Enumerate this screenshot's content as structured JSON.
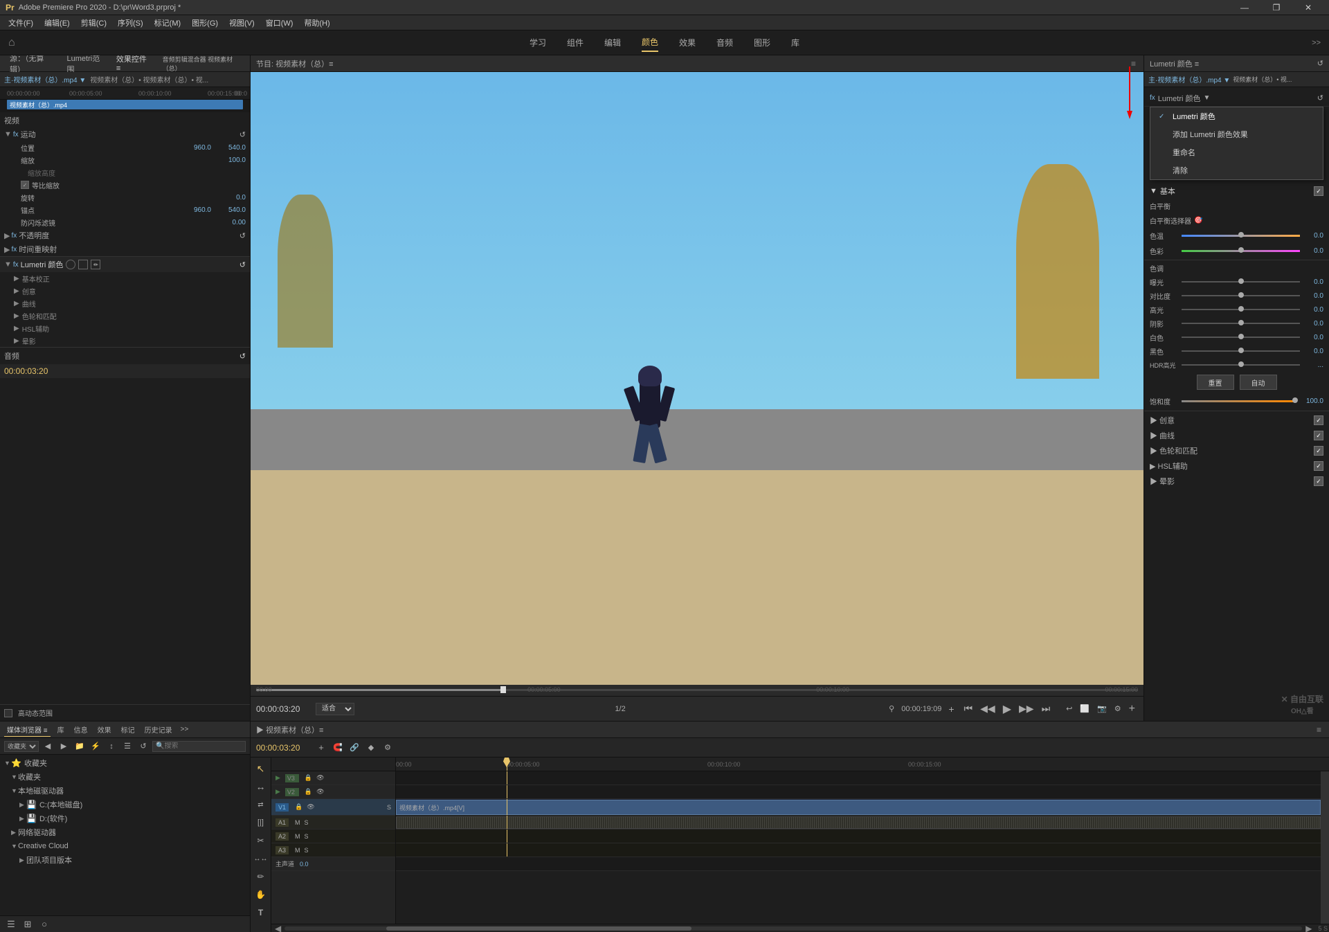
{
  "app": {
    "title": "Adobe Premiere Pro 2020 - D:\\pr\\Word3.prproj *",
    "minimize": "—",
    "restore": "❐",
    "close": "✕"
  },
  "menu": {
    "items": [
      "文件(F)",
      "编辑(E)",
      "剪辑(C)",
      "序列(S)",
      "标记(M)",
      "图形(G)",
      "视图(V)",
      "窗口(W)",
      "帮助(H)"
    ]
  },
  "top_nav": {
    "home_icon": "⌂",
    "tabs": [
      "学习",
      "组件",
      "编辑",
      "颜色",
      "效果",
      "音频",
      "图形",
      "库"
    ],
    "active_tab": "颜色",
    "more": ">>"
  },
  "source_panel": {
    "tabs": [
      "源：（无算辑）",
      "Lumetri范围",
      "效果控件",
      "音频剪辑混合器 视频素材（总）"
    ],
    "active_tab": "效果控件",
    "source_label": "主：视频素材（总）.mp4",
    "clip_path": "视频素材（总）• 视频素材（总）• 视..."
  },
  "timeline_ruler": {
    "markers": [
      "00:00:00:00",
      "00:00:05:00",
      "00:00:10:00",
      "00:00:15:00",
      "00:0"
    ]
  },
  "clip_bar": {
    "label": "视频素材（总）.mp4"
  },
  "effect_controls": {
    "video_label": "视频",
    "sections": [
      {
        "name": "运动",
        "fx": true,
        "properties": [
          {
            "name": "位置",
            "value": "960.0",
            "value2": "540.0"
          },
          {
            "name": "缩放",
            "value": "100.0"
          },
          {
            "name": "缩放高度"
          },
          {
            "name": "等比缩放",
            "checkbox": true,
            "checked": true
          },
          {
            "name": "旋转",
            "value": "0.0"
          },
          {
            "name": "锚点",
            "value": "960.0",
            "value2": "540.0"
          },
          {
            "name": "防闪烁滤镜",
            "value": "0.00"
          }
        ]
      },
      {
        "name": "不透明度",
        "fx": true
      },
      {
        "name": "时间重映射",
        "fx": true
      },
      {
        "name": "Lumetri颜色",
        "fx": true,
        "shapes": [
          "circle",
          "square",
          "pen"
        ],
        "subsections": [
          "基本校正",
          "创意",
          "曲线",
          "色轮和匹配",
          "HSL辅助",
          "晕影"
        ]
      }
    ],
    "hd_checkbox": "高动态范围"
  },
  "program_monitor": {
    "title": "节目: 视频素材（总）≡",
    "timecode": "00:00:03:20",
    "fit_label": "适合",
    "fraction": "1/2",
    "duration": "00:00:19:09",
    "ruler_marks": [
      "00:00",
      "00:00:05:00",
      "00:00:10:00",
      "00:00:15:00"
    ]
  },
  "transport": {
    "buttons": [
      "⏮",
      "◀◀",
      "▶",
      "▶▶",
      "⏭"
    ]
  },
  "lumetri_panel": {
    "title": "Lumetri 颜色 ≡",
    "source_label": "主·视频素材（总）.mp4 ▼ 视频素材（总）• 视...",
    "fx_row": {
      "label": "fx Lumetri 颜色",
      "dropdown_arrow": "▼"
    },
    "context_menu": {
      "items": [
        {
          "label": "Lumetri 颜色",
          "checked": true
        },
        {
          "label": "添加 Lumetri 颜色效果",
          "checked": false
        },
        {
          "label": "重命名",
          "checked": false
        },
        {
          "label": "清除",
          "checked": false
        }
      ]
    },
    "basic_correction": {
      "title": "基本",
      "white_balance": {
        "title": "白平衡",
        "selector": "白平衡选择器",
        "sliders": [
          {
            "name": "色温",
            "value": "0.0",
            "position": 50
          },
          {
            "name": "色彩",
            "value": "0.0",
            "position": 50
          }
        ]
      },
      "tone": {
        "title": "色调",
        "sliders": [
          {
            "name": "曝光",
            "value": "0.0",
            "position": 50
          },
          {
            "name": "对比度",
            "value": "0.0",
            "position": 50
          },
          {
            "name": "高光",
            "value": "0.0",
            "position": 50
          },
          {
            "name": "阴影",
            "value": "0.0",
            "position": 50
          },
          {
            "name": "白色",
            "value": "0.0",
            "position": 50
          },
          {
            "name": "黑色",
            "value": "0.0",
            "position": 50
          },
          {
            "name": "HDR高光",
            "value": "...",
            "position": 50
          }
        ]
      },
      "reset_btn": "重置",
      "match_btn": "自动",
      "saturation": {
        "name": "饱和度",
        "value": "100.0",
        "position": 100
      }
    },
    "checkboxes": [
      {
        "name": "创意",
        "checked": true
      },
      {
        "name": "曲线",
        "checked": true
      },
      {
        "name": "色轮和匹配",
        "checked": true
      },
      {
        "name": "HSL辅助",
        "checked": true
      },
      {
        "name": "晕影",
        "checked": true
      }
    ]
  },
  "media_browser": {
    "tabs": [
      "媒体浏览器",
      "库",
      "信息",
      "效果",
      "标记",
      "历史记录"
    ],
    "active_tab": "媒体浏览器",
    "tree": [
      {
        "label": "收藏夹",
        "indent": 0,
        "arrow": "▼"
      },
      {
        "label": "收藏夹",
        "indent": 1,
        "arrow": "▼"
      },
      {
        "label": "本地磁驱动器",
        "indent": 1,
        "arrow": "▼"
      },
      {
        "label": "C:(本地磁盘)",
        "indent": 2,
        "arrow": "▶",
        "icon": "💾"
      },
      {
        "label": "D:(软件)",
        "indent": 2,
        "arrow": "▶",
        "icon": "💾"
      },
      {
        "label": "网络驱动器",
        "indent": 1,
        "arrow": "▶"
      },
      {
        "label": "Creative Cloud",
        "indent": 1,
        "arrow": "▼"
      },
      {
        "label": "团队项目版本",
        "indent": 2,
        "arrow": "▶"
      }
    ]
  },
  "timeline": {
    "title": "视频素材（总）≡",
    "timecode": "00:00:03:20",
    "ruler_marks": [
      "00:00",
      "00:00:05:00",
      "00:00:10:00",
      "00:00:15:00"
    ],
    "tracks": [
      {
        "name": "V3",
        "type": "video"
      },
      {
        "name": "V2",
        "type": "video"
      },
      {
        "name": "V1",
        "type": "video",
        "active": true,
        "has_clip": true,
        "clip_label": "视频素材（总）.mp4[V]"
      },
      {
        "name": "A1",
        "type": "audio",
        "has_clip": true
      },
      {
        "name": "A2",
        "type": "audio"
      },
      {
        "name": "A3",
        "type": "audio"
      },
      {
        "name": "主声道",
        "type": "master",
        "value": "0.0"
      }
    ]
  },
  "watermark": "X 自由互联\nOH△看"
}
